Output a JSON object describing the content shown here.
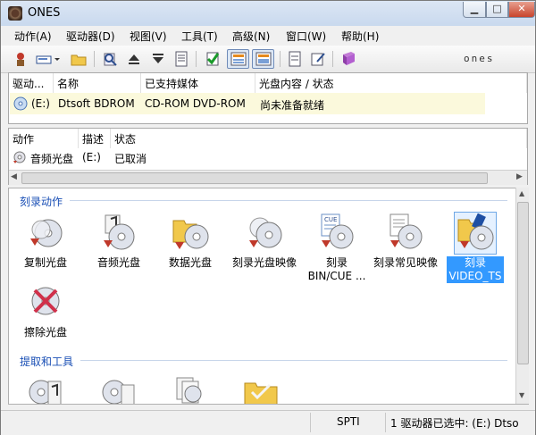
{
  "window": {
    "title": "ONES"
  },
  "menu": [
    "动作(A)",
    "驱动器(D)",
    "视图(V)",
    "工具(T)",
    "高级(N)",
    "窗口(W)",
    "帮助(H)"
  ],
  "brand": "ones",
  "drive_pane": {
    "columns": [
      "驱动...",
      "名称",
      "已支持媒体",
      "光盘内容 / 状态"
    ],
    "row": {
      "drive": "(E:)",
      "name": "Dtsoft BDROM",
      "media": "CD-ROM DVD-ROM",
      "status": "尚未准备就绪"
    }
  },
  "job_pane": {
    "columns": [
      "动作",
      "描述",
      "状态"
    ],
    "row": {
      "action": "音频光盘",
      "desc": "(E:)",
      "status": "已取消"
    }
  },
  "sections": {
    "burn": {
      "title": "刻录动作",
      "items": [
        {
          "label": "复制光盘"
        },
        {
          "label": "音频光盘"
        },
        {
          "label": "数据光盘"
        },
        {
          "label": "刻录光盘映像"
        },
        {
          "label": "刻录\nBIN/CUE ..."
        },
        {
          "label": "刻录常见映像"
        },
        {
          "label": "刻录\nVIDEO_TS"
        },
        {
          "label": "擦除光盘"
        }
      ]
    },
    "extract": {
      "title": "提取和工具"
    }
  },
  "status": {
    "interface": "SPTI",
    "selection": "1 驱动器已选中: (E:) Dtso"
  },
  "colors": {
    "accent": "#3399ff",
    "section_title": "#1a4fb5",
    "selected_row": "#fbf9dc"
  }
}
